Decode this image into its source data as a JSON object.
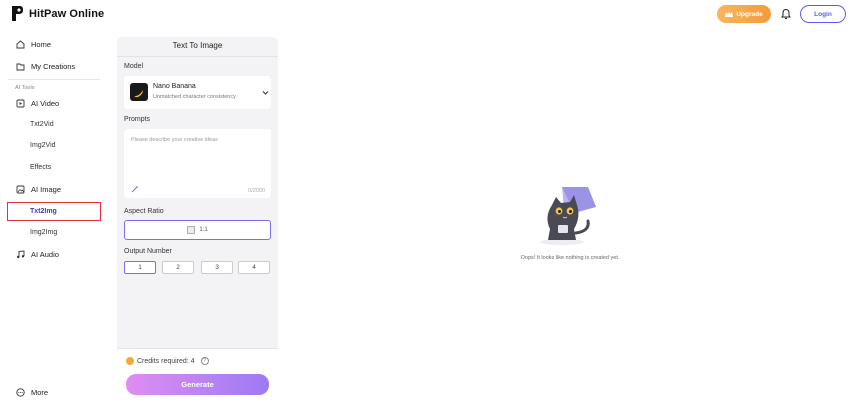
{
  "header": {
    "app_name": "HitPaw Online",
    "upgrade_label": "Upgrade",
    "login_label": "Login"
  },
  "sidebar": {
    "items": [
      {
        "label": "Home",
        "icon": "home-icon"
      },
      {
        "label": "My Creations",
        "icon": "folder-icon"
      }
    ],
    "section_label": "AI Tools",
    "ai_video": {
      "label": "AI Video",
      "icon": "video-icon",
      "sub": [
        "Txt2Vid",
        "Img2Vid",
        "Effects"
      ]
    },
    "ai_image": {
      "label": "AI Image",
      "icon": "image-icon",
      "sub": [
        "Txt2Img",
        "Img2Img"
      ],
      "active": "Txt2Img"
    },
    "ai_audio": {
      "label": "AI Audio",
      "icon": "music-icon"
    },
    "more_label": "More"
  },
  "panel": {
    "title": "Text To Image",
    "model_label": "Model",
    "model_name": "Nano Banana",
    "model_desc": "Unmatched character consistency",
    "prompts_label": "Prompts",
    "prompt_placeholder": "Please describe your creative ideas",
    "prompt_count": "0/2000",
    "aspect_label": "Aspect Ratio",
    "aspect_value": "1:1",
    "output_label": "Output Number",
    "output_options": [
      "1",
      "2",
      "3",
      "4"
    ],
    "output_selected": "1",
    "credits_label": "Credits required: 4",
    "generate_label": "Generate"
  },
  "empty_state": {
    "message": "Oops! It looks like nothing is created yet."
  },
  "colors": {
    "accent": "#5b5cf0",
    "upgrade": "#f5a83a",
    "active_border": "#e2323a"
  }
}
